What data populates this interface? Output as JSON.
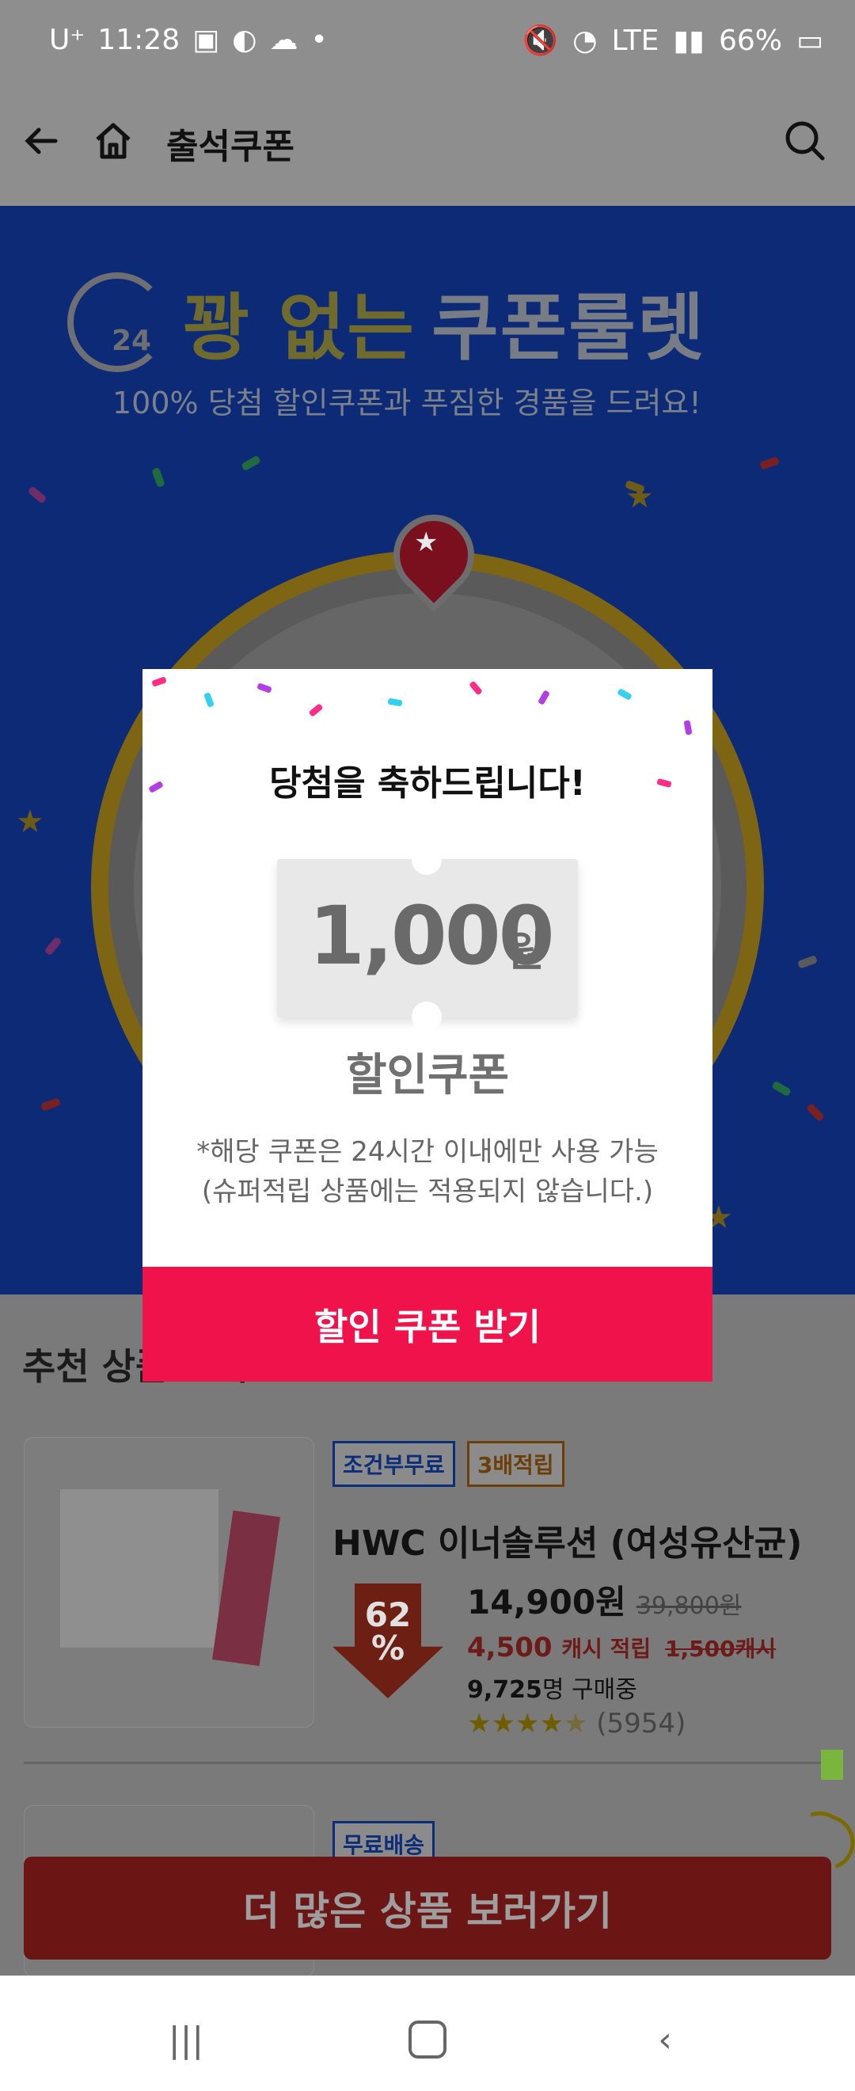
{
  "status_bar": {
    "carrier": "U⁺",
    "time": "11:28",
    "network": "LTE",
    "battery": "66%"
  },
  "app_bar": {
    "title": "출석쿠폰"
  },
  "hero": {
    "clock_text": "24",
    "title_part1": "꽝 없는",
    "title_part2": "쿠폰룰렛",
    "subtitle": "100% 당첨 할인쿠폰과 푸짐한 경품을 드려요!"
  },
  "modal": {
    "title": "당첨을 축하드립니다!",
    "coupon_amount": "1,000",
    "coupon_unit": "원",
    "coupon_label": "할인쿠폰",
    "note_line1": "*해당 쿠폰은 24시간 이내에만 사용 가능",
    "note_line2": "(슈퍼적립 상품에는 적용되지 않습니다.)",
    "cta": "할인 쿠폰 받기"
  },
  "recommended": {
    "title": "추천 상품 보기"
  },
  "product1": {
    "badge1": "조건부무료",
    "badge2": "3배적립",
    "name": "HWC 이너솔루션 (여성유산균)",
    "discount_line1": "62",
    "discount_line2": "%",
    "price": "14,900원",
    "original_price": "39,800원",
    "cash": "4,500",
    "cash_label": "캐시 적립",
    "cash_original": "1,500캐시",
    "buyers_count": "9,725",
    "buyers_suffix": "명 구매중",
    "rating": 4.5,
    "reviews": "(5954)"
  },
  "product2": {
    "badge": "무료배송"
  },
  "more_button": {
    "label": "더 많은 상품 보러가기"
  }
}
